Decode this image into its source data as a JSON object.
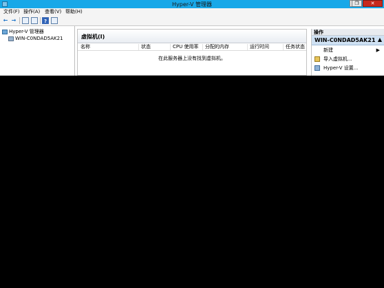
{
  "window": {
    "title": "Hyper-V 管理器"
  },
  "window_buttons": {
    "minimize": "—",
    "restore": "❐",
    "close": "✕"
  },
  "menu": [
    "文件(F)",
    "操作(A)",
    "查看(V)",
    "帮助(H)"
  ],
  "toolbar": {
    "back_icon": "←",
    "forward_icon": "→",
    "help_icon": "?"
  },
  "tree": {
    "root": "Hyper-V 管理器",
    "server": "WIN-C0NDAD5AK21"
  },
  "vm_panel": {
    "title": "虚拟机(I)",
    "columns": [
      "名称",
      "状态",
      "CPU 使用率",
      "分配的内存",
      "运行时间",
      "任务状态"
    ],
    "empty_message": "在此服务器上没有找到虚拟机。"
  },
  "actions": {
    "title": "操作",
    "server": "WIN-C0NDAD5AK21",
    "server_caret": "▲",
    "items": [
      {
        "label": "新建",
        "submenu": "▶"
      },
      {
        "label": "导入虚拟机..."
      },
      {
        "label": "Hyper-V 设置..."
      }
    ]
  }
}
